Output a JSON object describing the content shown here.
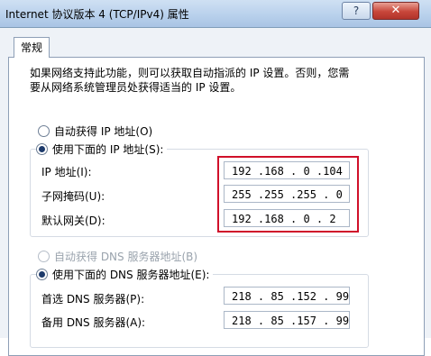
{
  "window": {
    "title": "Internet 协议版本 4 (TCP/IPv4) 属性",
    "help_label": "?",
    "close_label": "✕"
  },
  "tabs": [
    {
      "label": "常规"
    }
  ],
  "description": {
    "line1": "如果网络支持此功能，则可以获取自动指派的 IP 设置。否则，您需",
    "line2": "要从网络系统管理员处获得适当的 IP 设置。"
  },
  "ip": {
    "auto_label": "自动获得 IP 地址(O)",
    "manual_label": "使用下面的 IP 地址(S):",
    "selected": "manual",
    "fields": [
      {
        "label": "IP 地址(I):",
        "value": "192 .168 . 0  .104"
      },
      {
        "label": "子网掩码(U):",
        "value": "255 .255 .255 . 0"
      },
      {
        "label": "默认网关(D):",
        "value": "192 .168 . 0  . 2"
      }
    ]
  },
  "dns": {
    "auto_label": "自动获得 DNS 服务器地址(B)",
    "manual_label": "使用下面的 DNS 服务器地址(E):",
    "selected": "manual",
    "fields": [
      {
        "label": "首选 DNS 服务器(P):",
        "value": "218 . 85 .152 . 99"
      },
      {
        "label": "备用 DNS 服务器(A):",
        "value": "218 . 85 .157 . 99"
      }
    ]
  },
  "highlight_color": "#d0102a"
}
